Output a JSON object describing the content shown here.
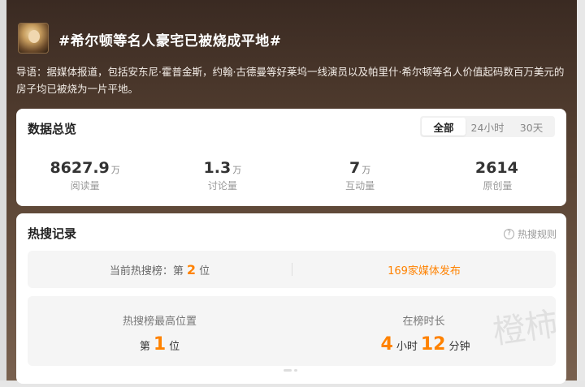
{
  "header": {
    "title": "#希尔顿等名人豪宅已被烧成平地#",
    "intro": "导语：据媒体报道，包括安东尼·霍普金斯，约翰·古德曼等好莱坞一线演员以及帕里什·希尔顿等名人价值起码数百万美元的房子均已被烧为一片平地。"
  },
  "overview": {
    "title": "数据总览",
    "tabs": [
      {
        "label": "全部",
        "active": true
      },
      {
        "label": "24小时",
        "active": false
      },
      {
        "label": "30天",
        "active": false
      }
    ],
    "stats": [
      {
        "value": "8627.9",
        "unit": "万",
        "label": "阅读量"
      },
      {
        "value": "1.3",
        "unit": "万",
        "label": "讨论量"
      },
      {
        "value": "7",
        "unit": "万",
        "label": "互动量"
      },
      {
        "value": "2614",
        "unit": "",
        "label": "原创量"
      }
    ]
  },
  "hot": {
    "title": "热搜记录",
    "rules_label": "热搜规则",
    "current_prefix": "当前热搜榜：第",
    "current_rank": "2",
    "current_suffix": "位",
    "media_text": "169家媒体发布",
    "best_label": "热搜榜最高位置",
    "best_prefix": "第",
    "best_rank": "1",
    "best_suffix": "位",
    "duration_label": "在榜时长",
    "duration_hours": "4",
    "hours_unit": "小时",
    "duration_minutes": "12",
    "minutes_unit": "分钟"
  },
  "watermark": "橙柿",
  "colors": {
    "accent": "#ff8200",
    "card": "#ffffff",
    "panel": "#f5f5f5"
  }
}
